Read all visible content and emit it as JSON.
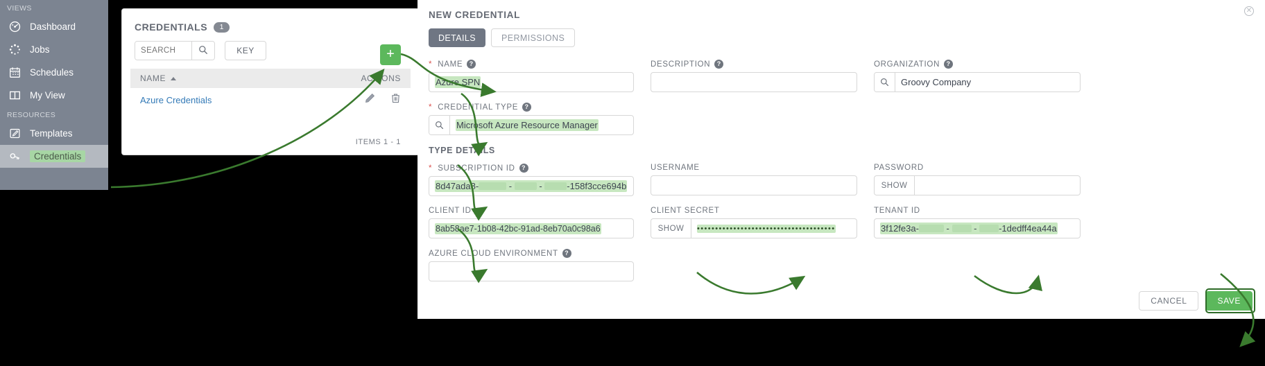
{
  "sidebar": {
    "sections": [
      {
        "label": "VIEWS",
        "items": [
          {
            "label": "Dashboard",
            "icon": "dashboard-icon"
          },
          {
            "label": "Jobs",
            "icon": "jobs-icon"
          },
          {
            "label": "Schedules",
            "icon": "calendar-icon"
          },
          {
            "label": "My View",
            "icon": "columns-icon"
          }
        ]
      },
      {
        "label": "RESOURCES",
        "items": [
          {
            "label": "Templates",
            "icon": "template-edit-icon"
          },
          {
            "label": "Credentials",
            "icon": "key-icon"
          }
        ]
      }
    ]
  },
  "list_panel": {
    "title": "CREDENTIALS",
    "count": "1",
    "search_placeholder": "SEARCH",
    "search_value": "",
    "key_button": "KEY",
    "columns": {
      "name": "NAME",
      "actions": "ACTIONS"
    },
    "rows": [
      {
        "name": "Azure Credentials",
        "edit_icon": "pencil-icon",
        "delete_icon": "trash-icon"
      }
    ],
    "items_count": "ITEMS 1 - 1",
    "add_button": "+"
  },
  "form": {
    "title": "NEW CREDENTIAL",
    "close_icon": "close-icon",
    "tabs": [
      {
        "label": "DETAILS",
        "active": true
      },
      {
        "label": "PERMISSIONS",
        "active": false
      }
    ],
    "fields": {
      "name": {
        "label": "NAME",
        "required": true,
        "value": "Azure SPN",
        "highlight": true
      },
      "description": {
        "label": "DESCRIPTION",
        "required": false,
        "value": "",
        "highlight": false
      },
      "organization": {
        "label": "ORGANIZATION",
        "required": false,
        "value": "Groovy Company",
        "icon": "search-icon",
        "highlight": false
      },
      "credential_type": {
        "label": "CREDENTIAL TYPE",
        "required": true,
        "value": "Microsoft Azure Resource Manager",
        "icon": "search-icon",
        "highlight": true
      },
      "subscription_id": {
        "label": "SUBSCRIPTION ID",
        "required": true,
        "value_prefix": "8d47ada8-",
        "value_suffix": "-158f3cce694b",
        "redacted": true,
        "highlight": true
      },
      "username": {
        "label": "USERNAME",
        "required": false,
        "value": "",
        "highlight": false
      },
      "password": {
        "label": "PASSWORD",
        "required": false,
        "value": "",
        "show_button": "SHOW",
        "highlight": false
      },
      "client_id": {
        "label": "CLIENT ID",
        "required": false,
        "value": "8ab58ae7-1b08-42bc-91ad-8eb70a0c98a6",
        "highlight": true
      },
      "client_secret": {
        "label": "CLIENT SECRET",
        "required": false,
        "value": "••••••••••••••••••••••••••••••••••••••",
        "show_button": "SHOW",
        "highlight": true
      },
      "tenant_id": {
        "label": "TENANT ID",
        "required": false,
        "value_prefix": "3f12fe3a-",
        "value_suffix": "-1dedff4ea44a",
        "redacted": true,
        "highlight": true
      },
      "azure_cloud_environment": {
        "label": "AZURE CLOUD ENVIRONMENT",
        "required": false,
        "value": "",
        "highlight": false
      }
    },
    "type_details_header": "TYPE DETAILS",
    "buttons": {
      "cancel": "CANCEL",
      "save": "SAVE"
    }
  },
  "colors": {
    "sidebar_bg": "#7c8491",
    "accent_green": "#5cb85c",
    "highlight_green": "#c7e7c0",
    "annotation_green": "#3a7a2e",
    "link_blue": "#337ab7",
    "required_red": "#d9534f"
  }
}
